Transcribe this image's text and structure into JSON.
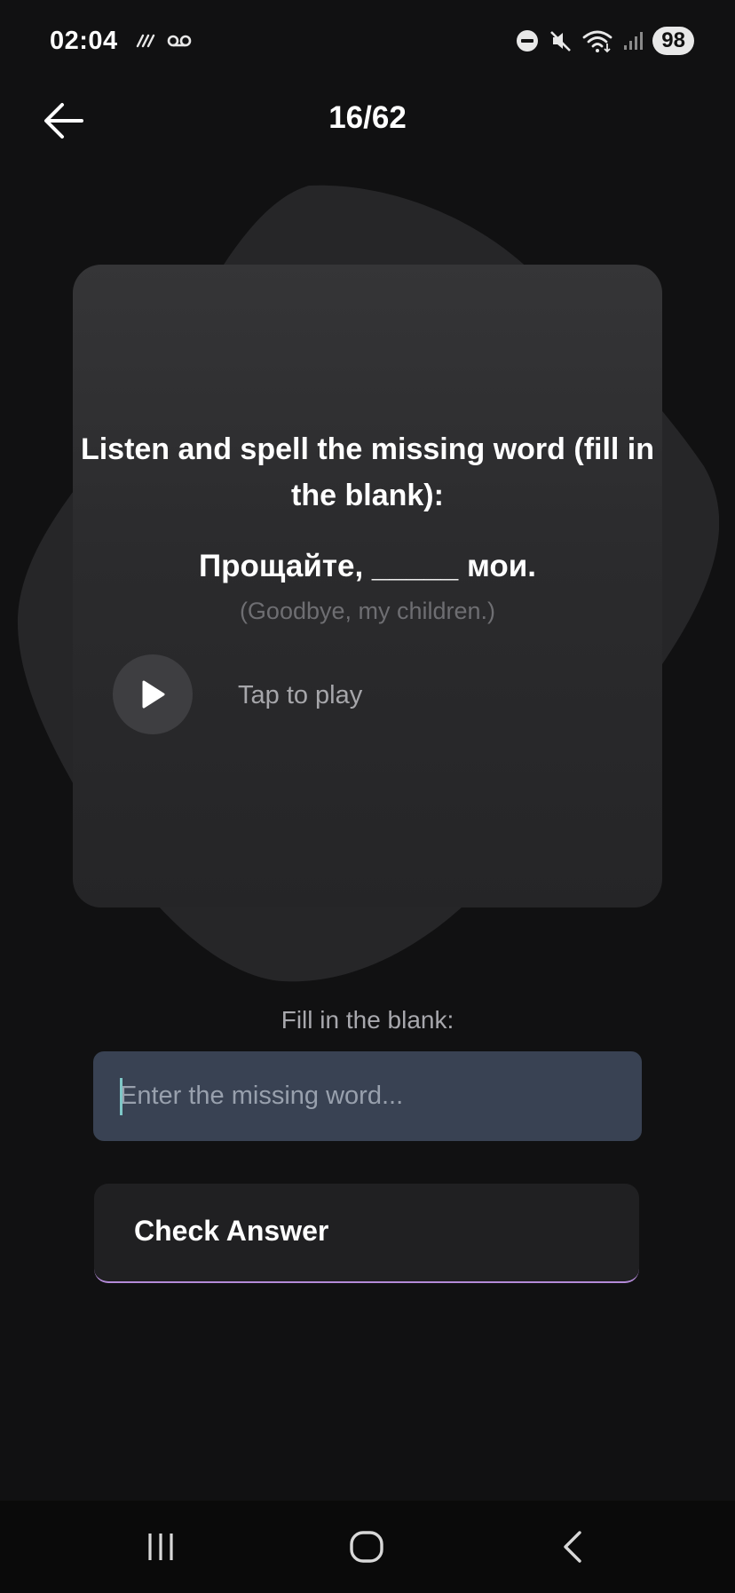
{
  "status_bar": {
    "time": "02:04",
    "battery": "98",
    "icons": [
      "voicemail-icon",
      "dnd-icon",
      "mute-icon",
      "wifi-icon",
      "signal-icon"
    ]
  },
  "header": {
    "back_icon": "arrow-left-icon",
    "progress": "16/62"
  },
  "card": {
    "instruction": "Listen and spell the missing word (fill in the blank):",
    "sentence": "Прощайте, _____ мои.",
    "translation": "(Goodbye, my children.)",
    "play_icon": "play-icon",
    "play_label": "Tap to play"
  },
  "answer": {
    "label": "Fill in the blank:",
    "placeholder": "Enter the missing word...",
    "value": ""
  },
  "check_button": {
    "label": "Check Answer"
  },
  "nav_bar": {
    "items": [
      "recents-icon",
      "home-icon",
      "back-icon"
    ]
  },
  "colors": {
    "background": "#111112",
    "card": "#2f2f31",
    "input": "#394253",
    "accent_underline": "#b48ad8",
    "caret": "#7ec7c7"
  }
}
